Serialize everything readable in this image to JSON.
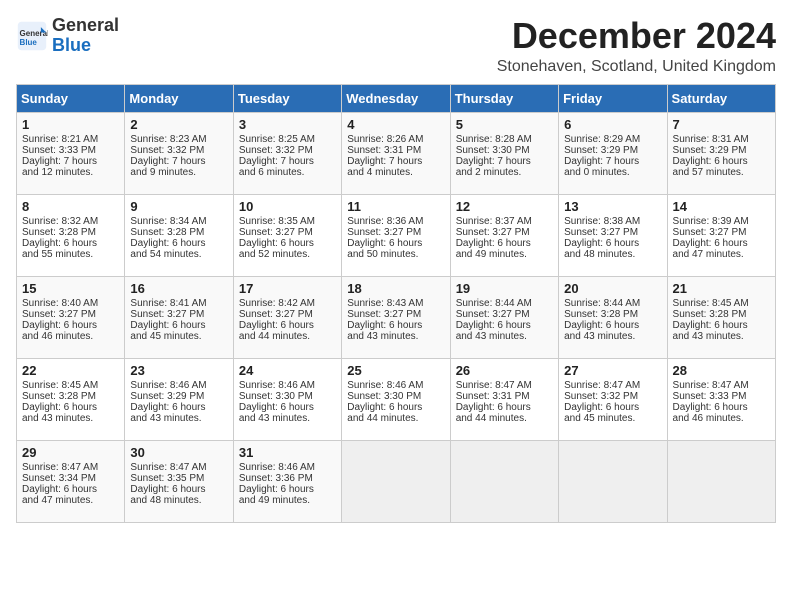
{
  "logo": {
    "general": "General",
    "blue": "Blue"
  },
  "title": "December 2024",
  "location": "Stonehaven, Scotland, United Kingdom",
  "headers": [
    "Sunday",
    "Monday",
    "Tuesday",
    "Wednesday",
    "Thursday",
    "Friday",
    "Saturday"
  ],
  "weeks": [
    [
      {
        "day": "1",
        "lines": [
          "Sunrise: 8:21 AM",
          "Sunset: 3:33 PM",
          "Daylight: 7 hours",
          "and 12 minutes."
        ]
      },
      {
        "day": "2",
        "lines": [
          "Sunrise: 8:23 AM",
          "Sunset: 3:32 PM",
          "Daylight: 7 hours",
          "and 9 minutes."
        ]
      },
      {
        "day": "3",
        "lines": [
          "Sunrise: 8:25 AM",
          "Sunset: 3:32 PM",
          "Daylight: 7 hours",
          "and 6 minutes."
        ]
      },
      {
        "day": "4",
        "lines": [
          "Sunrise: 8:26 AM",
          "Sunset: 3:31 PM",
          "Daylight: 7 hours",
          "and 4 minutes."
        ]
      },
      {
        "day": "5",
        "lines": [
          "Sunrise: 8:28 AM",
          "Sunset: 3:30 PM",
          "Daylight: 7 hours",
          "and 2 minutes."
        ]
      },
      {
        "day": "6",
        "lines": [
          "Sunrise: 8:29 AM",
          "Sunset: 3:29 PM",
          "Daylight: 7 hours",
          "and 0 minutes."
        ]
      },
      {
        "day": "7",
        "lines": [
          "Sunrise: 8:31 AM",
          "Sunset: 3:29 PM",
          "Daylight: 6 hours",
          "and 57 minutes."
        ]
      }
    ],
    [
      {
        "day": "8",
        "lines": [
          "Sunrise: 8:32 AM",
          "Sunset: 3:28 PM",
          "Daylight: 6 hours",
          "and 55 minutes."
        ]
      },
      {
        "day": "9",
        "lines": [
          "Sunrise: 8:34 AM",
          "Sunset: 3:28 PM",
          "Daylight: 6 hours",
          "and 54 minutes."
        ]
      },
      {
        "day": "10",
        "lines": [
          "Sunrise: 8:35 AM",
          "Sunset: 3:27 PM",
          "Daylight: 6 hours",
          "and 52 minutes."
        ]
      },
      {
        "day": "11",
        "lines": [
          "Sunrise: 8:36 AM",
          "Sunset: 3:27 PM",
          "Daylight: 6 hours",
          "and 50 minutes."
        ]
      },
      {
        "day": "12",
        "lines": [
          "Sunrise: 8:37 AM",
          "Sunset: 3:27 PM",
          "Daylight: 6 hours",
          "and 49 minutes."
        ]
      },
      {
        "day": "13",
        "lines": [
          "Sunrise: 8:38 AM",
          "Sunset: 3:27 PM",
          "Daylight: 6 hours",
          "and 48 minutes."
        ]
      },
      {
        "day": "14",
        "lines": [
          "Sunrise: 8:39 AM",
          "Sunset: 3:27 PM",
          "Daylight: 6 hours",
          "and 47 minutes."
        ]
      }
    ],
    [
      {
        "day": "15",
        "lines": [
          "Sunrise: 8:40 AM",
          "Sunset: 3:27 PM",
          "Daylight: 6 hours",
          "and 46 minutes."
        ]
      },
      {
        "day": "16",
        "lines": [
          "Sunrise: 8:41 AM",
          "Sunset: 3:27 PM",
          "Daylight: 6 hours",
          "and 45 minutes."
        ]
      },
      {
        "day": "17",
        "lines": [
          "Sunrise: 8:42 AM",
          "Sunset: 3:27 PM",
          "Daylight: 6 hours",
          "and 44 minutes."
        ]
      },
      {
        "day": "18",
        "lines": [
          "Sunrise: 8:43 AM",
          "Sunset: 3:27 PM",
          "Daylight: 6 hours",
          "and 43 minutes."
        ]
      },
      {
        "day": "19",
        "lines": [
          "Sunrise: 8:44 AM",
          "Sunset: 3:27 PM",
          "Daylight: 6 hours",
          "and 43 minutes."
        ]
      },
      {
        "day": "20",
        "lines": [
          "Sunrise: 8:44 AM",
          "Sunset: 3:28 PM",
          "Daylight: 6 hours",
          "and 43 minutes."
        ]
      },
      {
        "day": "21",
        "lines": [
          "Sunrise: 8:45 AM",
          "Sunset: 3:28 PM",
          "Daylight: 6 hours",
          "and 43 minutes."
        ]
      }
    ],
    [
      {
        "day": "22",
        "lines": [
          "Sunrise: 8:45 AM",
          "Sunset: 3:28 PM",
          "Daylight: 6 hours",
          "and 43 minutes."
        ]
      },
      {
        "day": "23",
        "lines": [
          "Sunrise: 8:46 AM",
          "Sunset: 3:29 PM",
          "Daylight: 6 hours",
          "and 43 minutes."
        ]
      },
      {
        "day": "24",
        "lines": [
          "Sunrise: 8:46 AM",
          "Sunset: 3:30 PM",
          "Daylight: 6 hours",
          "and 43 minutes."
        ]
      },
      {
        "day": "25",
        "lines": [
          "Sunrise: 8:46 AM",
          "Sunset: 3:30 PM",
          "Daylight: 6 hours",
          "and 44 minutes."
        ]
      },
      {
        "day": "26",
        "lines": [
          "Sunrise: 8:47 AM",
          "Sunset: 3:31 PM",
          "Daylight: 6 hours",
          "and 44 minutes."
        ]
      },
      {
        "day": "27",
        "lines": [
          "Sunrise: 8:47 AM",
          "Sunset: 3:32 PM",
          "Daylight: 6 hours",
          "and 45 minutes."
        ]
      },
      {
        "day": "28",
        "lines": [
          "Sunrise: 8:47 AM",
          "Sunset: 3:33 PM",
          "Daylight: 6 hours",
          "and 46 minutes."
        ]
      }
    ],
    [
      {
        "day": "29",
        "lines": [
          "Sunrise: 8:47 AM",
          "Sunset: 3:34 PM",
          "Daylight: 6 hours",
          "and 47 minutes."
        ]
      },
      {
        "day": "30",
        "lines": [
          "Sunrise: 8:47 AM",
          "Sunset: 3:35 PM",
          "Daylight: 6 hours",
          "and 48 minutes."
        ]
      },
      {
        "day": "31",
        "lines": [
          "Sunrise: 8:46 AM",
          "Sunset: 3:36 PM",
          "Daylight: 6 hours",
          "and 49 minutes."
        ]
      },
      null,
      null,
      null,
      null
    ]
  ]
}
